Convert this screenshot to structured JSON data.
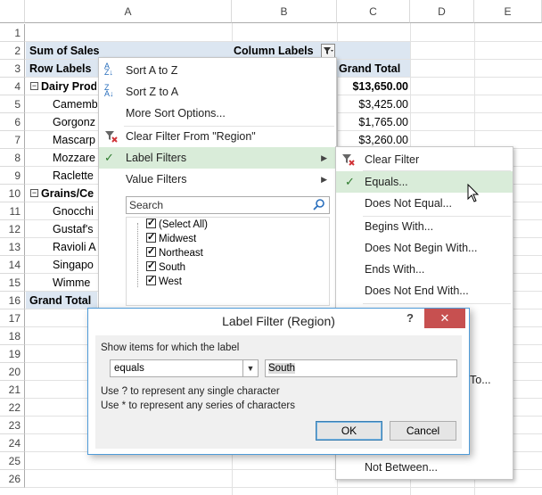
{
  "columns": [
    "A",
    "B",
    "C",
    "D",
    "E"
  ],
  "rows": [
    "1",
    "2",
    "3",
    "4",
    "5",
    "6",
    "7",
    "8",
    "9",
    "10",
    "11",
    "12",
    "13",
    "14",
    "15",
    "16",
    "17",
    "18",
    "19",
    "20",
    "21",
    "22",
    "23",
    "24",
    "25",
    "26"
  ],
  "pivot": {
    "sum_label": "Sum of Sales",
    "col_labels": "Column Labels",
    "row_labels": "Row Labels",
    "grand_total_header": "Grand Total",
    "dairy": "Dairy Prod",
    "camembert": "Camemb",
    "gorgonzola": "Gorgonz",
    "mascarpone": "Mascarp",
    "mozzarella": "Mozzare",
    "raclette": "Raclette",
    "grains": "Grains/Ce",
    "gnocchi": "Gnocchi",
    "gustafs": "Gustaf's",
    "ravioli": "Ravioli A",
    "singapore": "Singapo",
    "wimmers": "Wimme",
    "grand_total": "Grand Total",
    "v_dairy": "$13,650.00",
    "v_camembert": "$3,425.00",
    "v_gorgonzola": "$1,765.00",
    "v_mascarpone": "$3,260.00"
  },
  "menu": {
    "sort_az": "Sort A to Z",
    "sort_za": "Sort Z to A",
    "more_sort": "More Sort Options...",
    "clear_filter": "Clear Filter From \"Region\"",
    "label_filters": "Label Filters",
    "value_filters": "Value Filters",
    "search_placeholder": "Search",
    "items": [
      "(Select All)",
      "Midwest",
      "Northeast",
      "South",
      "West"
    ]
  },
  "submenu": {
    "clear_filter": "Clear Filter",
    "equals": "Equals...",
    "not_equal": "Does Not Equal...",
    "begins_with": "Begins With...",
    "not_begin": "Does Not Begin With...",
    "ends_with": "Ends With...",
    "not_end": "Does Not End With...",
    "contains_tail": "To...",
    "not_between": "Not Between..."
  },
  "dialog": {
    "title": "Label Filter (Region)",
    "help": "?",
    "close": "✕",
    "group_label": "Show items for which the label",
    "operator": "equals",
    "value": "South",
    "hint1": "Use ? to represent any single character",
    "hint2": "Use * to represent any series of characters",
    "ok": "OK",
    "cancel": "Cancel"
  },
  "colors": {
    "accent": "#2a6fbd",
    "highlight": "#d9ecd9",
    "band": "#dce6f1",
    "close": "#c75050"
  }
}
